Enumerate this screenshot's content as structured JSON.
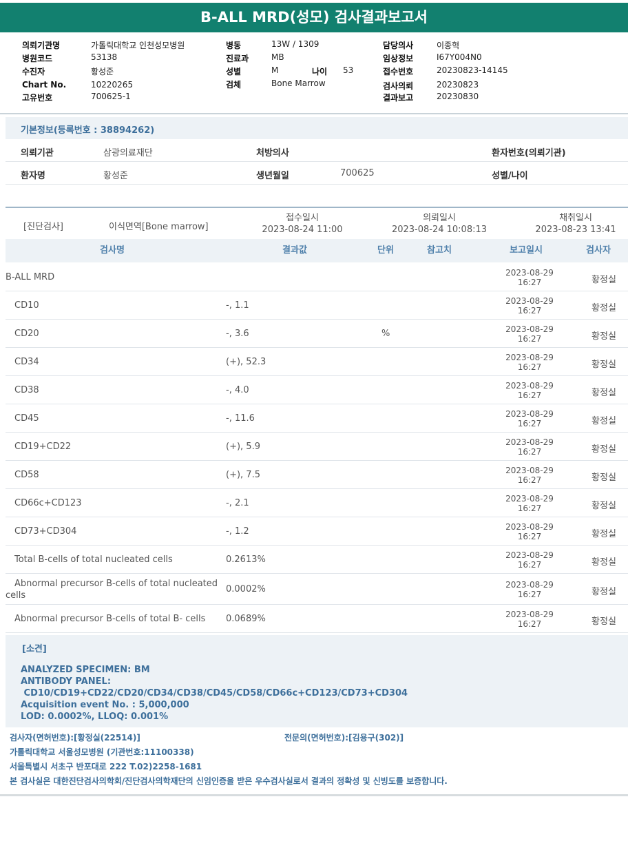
{
  "title": "B-ALL MRD(성모) 검사결과보고서",
  "header": {
    "col1": [
      {
        "label": "의뢰기관명",
        "value": "가톨릭대학교 인천성모병원"
      },
      {
        "label": "병원코드",
        "value": "53138"
      },
      {
        "label": "수진자",
        "value": "황성준"
      },
      {
        "label": "Chart No.",
        "value": "10220265"
      },
      {
        "label": "고유번호",
        "value": "700625-1"
      }
    ],
    "col2": [
      {
        "label": "병동",
        "value": "13W / 1309"
      },
      {
        "label": "진료과",
        "value": "MB"
      },
      {
        "label": "성별",
        "value": "M"
      },
      {
        "label": "검체",
        "value": "Bone Marrow"
      }
    ],
    "age_label": "나이",
    "age_value": "53",
    "col3": [
      {
        "label": "담당의사",
        "value": "이종혁"
      },
      {
        "label": "임상정보",
        "value": "I67Y004N0"
      },
      {
        "label": "접수번호",
        "value": "20230823-14145"
      },
      {
        "label": "검사의뢰",
        "value": "20230823"
      },
      {
        "label": "결과보고",
        "value": "20230830"
      }
    ]
  },
  "basic": {
    "title": "기본정보(등록번호 : 38894262)",
    "institution_label": "의뢰기관",
    "institution_value": "삼광의료재단",
    "doctor_label": "처방의사",
    "patient_no_label": "환자번호(의뢰기관)",
    "name_label": "환자명",
    "name_value": "황성준",
    "birth_label": "생년월일",
    "birth_value": "700625",
    "sex_age_label": "성별/나이"
  },
  "test_meta": {
    "category": "[진단검사]",
    "specimen": "이식면역[Bone marrow]",
    "received_label": "접수일시",
    "received_value": "2023-08-24 11:00",
    "requested_label": "의뢰일시",
    "requested_value": "2023-08-24 10:08:13",
    "collected_label": "채취일시",
    "collected_value": "2023-08-23 13:41"
  },
  "table": {
    "headers": {
      "name": "검사명",
      "result": "결과값",
      "unit": "단위",
      "ref": "참고치",
      "report_date": "보고일시",
      "examiner": "검사자"
    },
    "rows": [
      {
        "name": "B-ALL MRD",
        "result": "",
        "unit": "",
        "date": "2023-08-29",
        "time": "16:27",
        "examiner": "황정실"
      },
      {
        "name": "CD10",
        "result": "-, 1.1",
        "unit": "",
        "date": "2023-08-29",
        "time": "16:27",
        "examiner": "황정실"
      },
      {
        "name": "CD20",
        "result": "-, 3.6",
        "unit": "%",
        "date": "2023-08-29",
        "time": "16:27",
        "examiner": "황정실"
      },
      {
        "name": "CD34",
        "result": "(+), 52.3",
        "unit": "",
        "date": "2023-08-29",
        "time": "16:27",
        "examiner": "황정실"
      },
      {
        "name": "CD38",
        "result": "-, 4.0",
        "unit": "",
        "date": "2023-08-29",
        "time": "16:27",
        "examiner": "황정실"
      },
      {
        "name": "CD45",
        "result": "-, 11.6",
        "unit": "",
        "date": "2023-08-29",
        "time": "16:27",
        "examiner": "황정실"
      },
      {
        "name": "CD19+CD22",
        "result": "(+), 5.9",
        "unit": "",
        "date": "2023-08-29",
        "time": "16:27",
        "examiner": "황정실"
      },
      {
        "name": "CD58",
        "result": "(+), 7.5",
        "unit": "",
        "date": "2023-08-29",
        "time": "16:27",
        "examiner": "황정실"
      },
      {
        "name": "CD66c+CD123",
        "result": "-, 2.1",
        "unit": "",
        "date": "2023-08-29",
        "time": "16:27",
        "examiner": "황정실"
      },
      {
        "name": "CD73+CD304",
        "result": "-, 1.2",
        "unit": "",
        "date": "2023-08-29",
        "time": "16:27",
        "examiner": "황정실"
      },
      {
        "name": "Total B-cells of total nucleated cells",
        "result": "0.2613%",
        "unit": "",
        "date": "2023-08-29",
        "time": "16:27",
        "examiner": "황정실"
      },
      {
        "name": "Abnormal precursor B-cells of total nucleated cells",
        "result": "0.0002%",
        "unit": "",
        "date": "2023-08-29",
        "time": "16:27",
        "examiner": "황정실"
      },
      {
        "name": "Abnormal precursor B-cells of total B- cells",
        "result": "0.0689%",
        "unit": "",
        "date": "2023-08-29",
        "time": "16:27",
        "examiner": "황정실"
      }
    ]
  },
  "opinion": {
    "title": "[소견]",
    "text": "ANALYZED SPECIMEN: BM\nANTIBODY PANEL:\n CD10/CD19+CD22/CD20/CD34/CD38/CD45/CD58/CD66c+CD123/CD73+CD304\nAcquisition event No. : 5,000,000\nLOD: 0.0002%, LLOQ: 0.001%"
  },
  "footer": {
    "examiner": "검사자(면허번호):[황정실(22514)]",
    "specialist": "전문의(면허번호):[김용구(302)]",
    "hospital": "가톨릭대학교 서울성모병원 (기관번호:11100338)",
    "address": "서울특별시 서초구 반포대로 222 T.02)2258-1681",
    "certification": "본 검사실은 대한진단검사의학회/진단검사의학재단의 신임인증을 받은 우수검사실로서 결과의 정확성 및 신빙도를 보증합니다."
  }
}
